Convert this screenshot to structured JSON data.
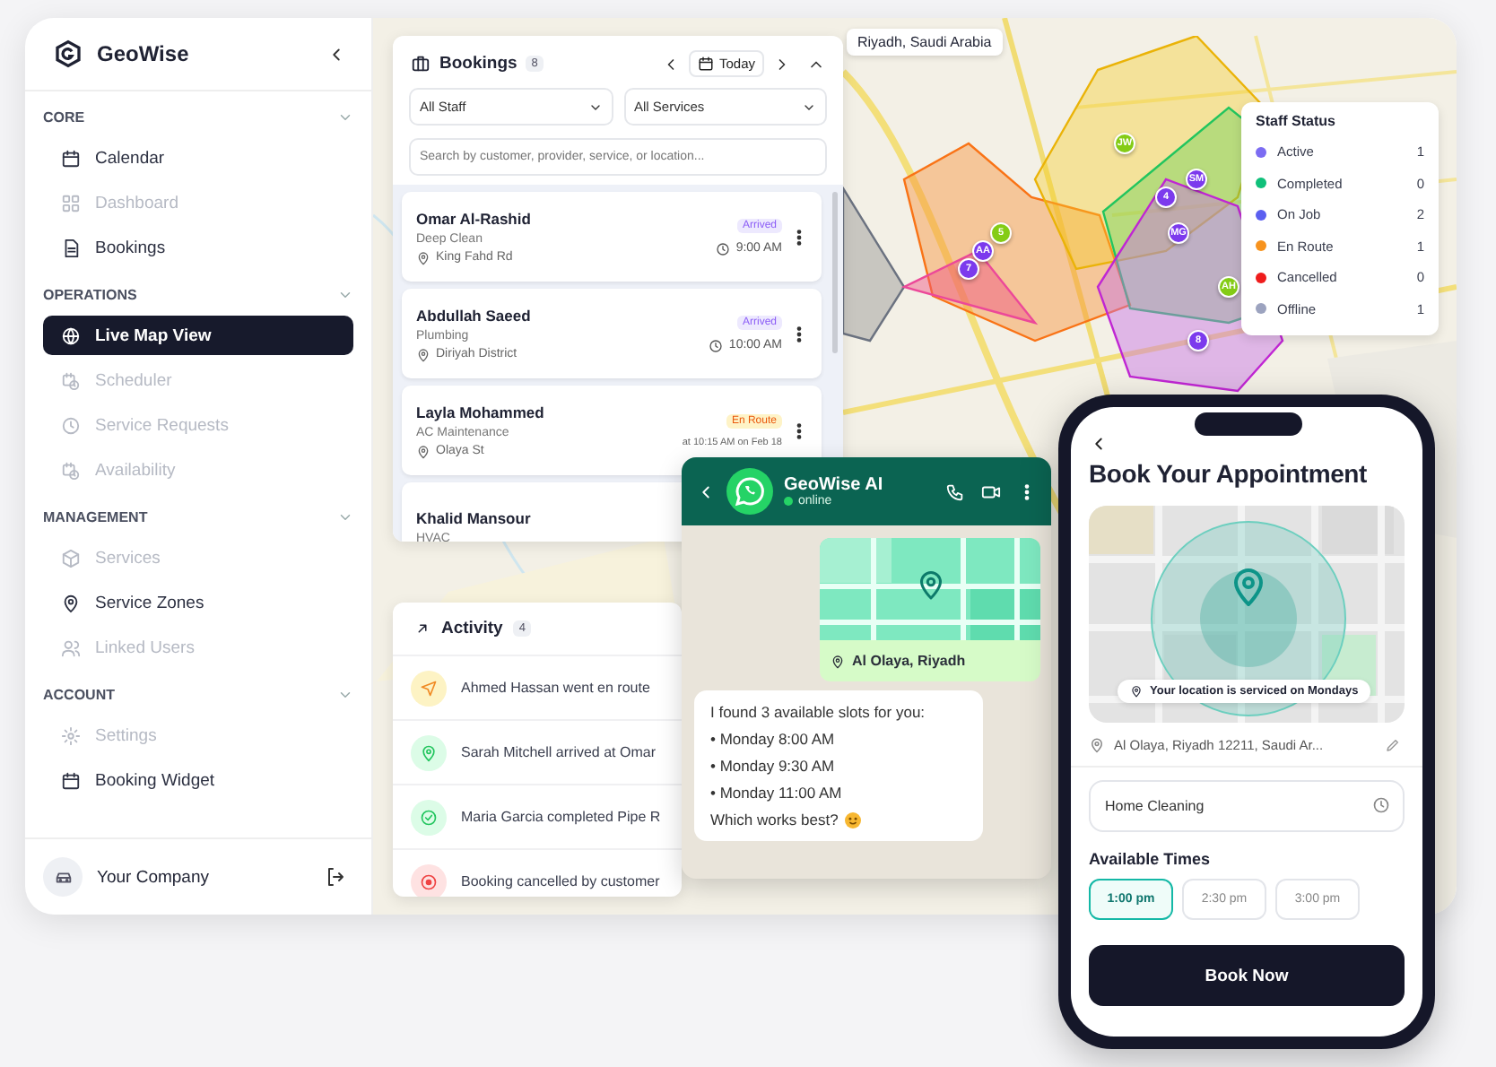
{
  "sidebar": {
    "brand": "GeoWise",
    "sections": [
      {
        "title": "CORE",
        "items": [
          {
            "label": "Calendar",
            "disabled": false,
            "selected": false
          },
          {
            "label": "Dashboard",
            "disabled": true,
            "selected": false
          },
          {
            "label": "Bookings",
            "disabled": false,
            "selected": false
          }
        ]
      },
      {
        "title": "OPERATIONS",
        "items": [
          {
            "label": "Live Map View",
            "disabled": false,
            "selected": true
          },
          {
            "label": "Scheduler",
            "disabled": true,
            "selected": false
          },
          {
            "label": "Service Requests",
            "disabled": true,
            "selected": false
          },
          {
            "label": "Availability",
            "disabled": true,
            "selected": false
          }
        ]
      },
      {
        "title": "MANAGEMENT",
        "items": [
          {
            "label": "Services",
            "disabled": true,
            "selected": false
          },
          {
            "label": "Service Zones",
            "disabled": false,
            "selected": false
          },
          {
            "label": "Linked Users",
            "disabled": true,
            "selected": false
          }
        ]
      },
      {
        "title": "ACCOUNT",
        "items": [
          {
            "label": "Settings",
            "disabled": true,
            "selected": false
          },
          {
            "label": "Booking Widget",
            "disabled": false,
            "selected": false
          }
        ]
      }
    ],
    "footer": {
      "company": "Your Company"
    }
  },
  "bookings": {
    "title": "Bookings",
    "count": "8",
    "date_label": "Today",
    "filters": [
      {
        "value": "All Staff"
      },
      {
        "value": "All Services"
      }
    ],
    "search": {
      "placeholder": "Search by customer, provider, service, or location..."
    },
    "items": [
      {
        "name": "Omar Al-Rashid",
        "service": "Deep Clean",
        "location": "King Fahd Rd",
        "status": {
          "label": "Arrived",
          "kind": "arrived"
        },
        "kind": "scheduled",
        "time": "9:00 AM"
      },
      {
        "name": "Abdullah Saeed",
        "service": "Plumbing",
        "location": "Diriyah District",
        "status": {
          "label": "Arrived",
          "kind": "arrived"
        },
        "kind": "scheduled",
        "time": "10:00 AM"
      },
      {
        "name": "Layla Mohammed",
        "service": "AC Maintenance",
        "location": "Olaya St",
        "status": {
          "label": "En Route",
          "kind": "en_route"
        },
        "kind": "eta",
        "time": "at 10:15 AM on Feb 18"
      },
      {
        "name": "Khalid Mansour",
        "service": "HVAC"
      }
    ]
  },
  "activity": {
    "title": "Activity",
    "count": "4",
    "items": [
      {
        "text": "Ahmed Hassan went en route",
        "kind": "en_route"
      },
      {
        "text": "Sarah Mitchell arrived at Omar",
        "kind": "arrived"
      },
      {
        "text": "Maria Garcia completed Pipe R",
        "kind": "completed"
      },
      {
        "text": "Booking cancelled by customer",
        "kind": "cancelled"
      }
    ]
  },
  "map": {
    "location": "Riyadh, Saudi Arabia",
    "markers": [
      {
        "label": "JW",
        "color": "#84cc16"
      },
      {
        "label": "SM",
        "color": "#7c3aed"
      },
      {
        "label": "4",
        "color": "#7c3aed"
      },
      {
        "label": "MG",
        "color": "#7c3aed"
      },
      {
        "label": "5",
        "color": "#84cc16"
      },
      {
        "label": "AA",
        "color": "#7c3aed"
      },
      {
        "label": "7",
        "color": "#7c3aed"
      },
      {
        "label": "AH",
        "color": "#84cc16"
      },
      {
        "label": "8",
        "color": "#7c3aed"
      }
    ],
    "legend": {
      "title": "Staff Status",
      "items": [
        {
          "label": "Active",
          "count": "1",
          "color": "#7c6cf2"
        },
        {
          "label": "Completed",
          "count": "0",
          "color": "#10c07a"
        },
        {
          "label": "On Job",
          "count": "2",
          "color": "#5b5ff0"
        },
        {
          "label": "En Route",
          "count": "1",
          "color": "#f7931e"
        },
        {
          "label": "Cancelled",
          "count": "0",
          "color": "#ef1c1c"
        },
        {
          "label": "Offline",
          "count": "1",
          "color": "#9ca3bf"
        }
      ]
    }
  },
  "chat": {
    "name": "GeoWise AI",
    "status": "online",
    "location_label": "Al Olaya, Riyadh",
    "message": {
      "intro": "I found 3 available slots for you:",
      "slots": [
        "• Monday 8:00 AM",
        "• Monday 9:30 AM",
        "• Monday 11:00 AM"
      ],
      "closing": "Which works best?"
    }
  },
  "phone": {
    "title": "Book Your Appointment",
    "map_notice": "Your location is serviced on Mondays",
    "address": "Al Olaya, Riyadh 12211, Saudi Ar...",
    "service": {
      "value": "Home Cleaning"
    },
    "times_title": "Available Times",
    "times": [
      {
        "label": "1:00 pm",
        "selected": true
      },
      {
        "label": "2:30 pm",
        "selected": false
      },
      {
        "label": "3:00 pm",
        "selected": false
      }
    ],
    "action": "Book Now"
  }
}
